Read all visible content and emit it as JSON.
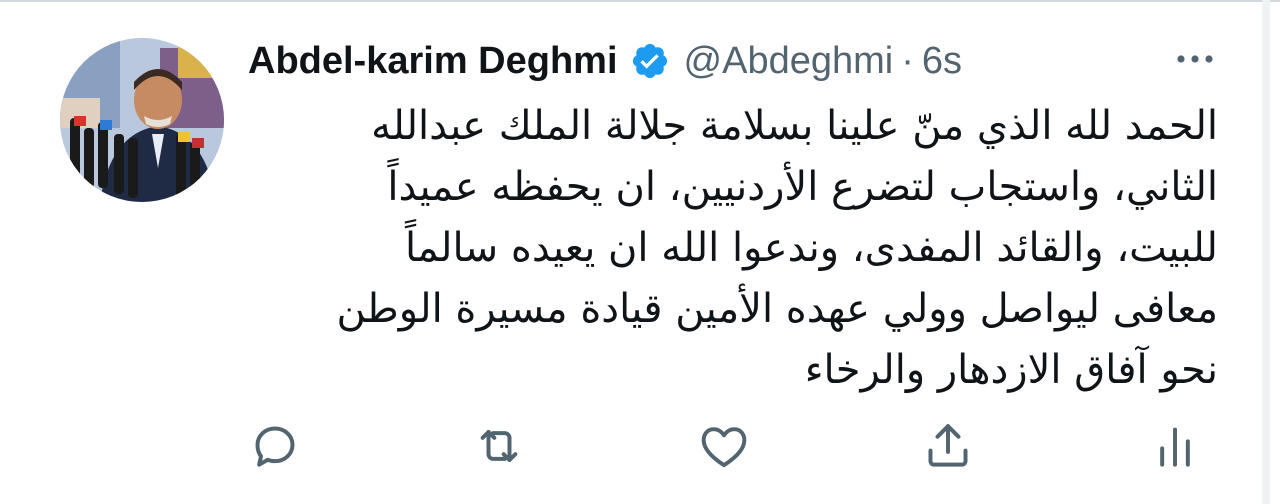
{
  "tweet": {
    "author": {
      "name": "Abdel-karim Deghmi",
      "handle": "@Abdeghmi",
      "verified": true,
      "avatar_icon": "avatar-photo"
    },
    "separator": "·",
    "time": "6s",
    "text_lines": [
      "الحمد لله الذي منّ علينا  بسلامة جلالة الملك عبدالله",
      "الثاني، واستجاب لتضرع الأردنيين، ان يحفظه عميداً",
      "للبيت، والقائد المفدى، وندعوا الله ان يعيده سالماً",
      "معافى ليواصل وولي عهده الأمين قيادة مسيرة الوطن",
      "نحو آفاق الازدهار والرخاء"
    ],
    "actions": [
      {
        "name": "reply",
        "icon": "reply-icon"
      },
      {
        "name": "retweet",
        "icon": "retweet-icon"
      },
      {
        "name": "like",
        "icon": "heart-icon"
      },
      {
        "name": "share",
        "icon": "share-icon"
      },
      {
        "name": "analytics",
        "icon": "analytics-icon"
      }
    ]
  },
  "colors": {
    "text": "#0f1419",
    "secondary": "#536471",
    "verified": "#1d9bf0",
    "border": "#cfd9de"
  }
}
